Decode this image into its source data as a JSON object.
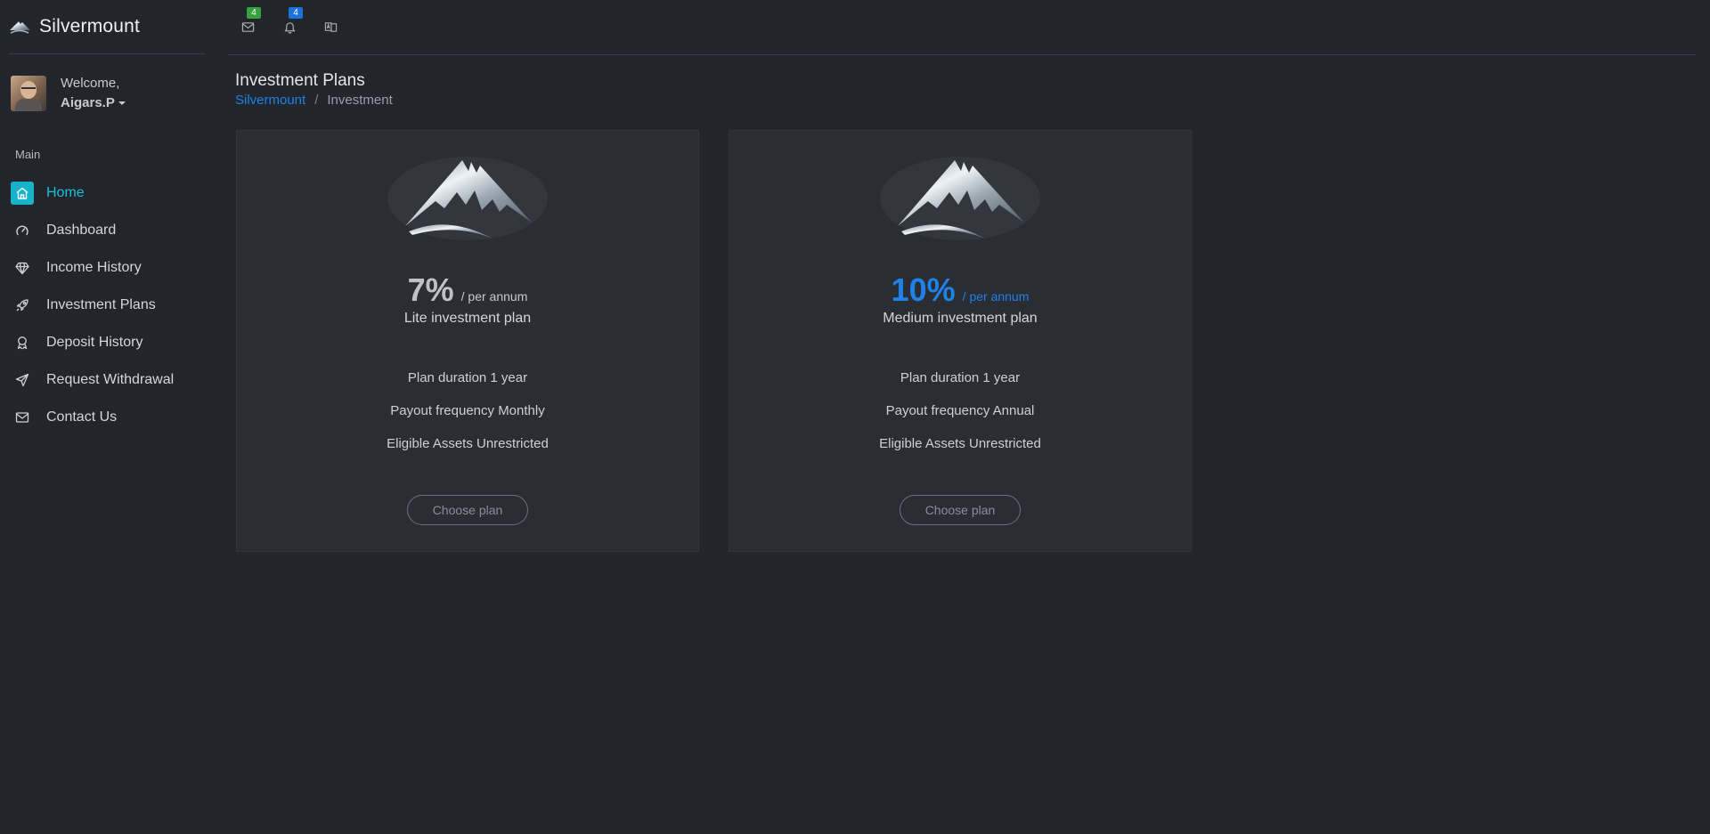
{
  "brand": {
    "name": "Silvermount",
    "logo_icon": "mountain-logo-icon"
  },
  "user": {
    "welcome": "Welcome,",
    "name": "Aigars.P"
  },
  "sidebar": {
    "section_label": "Main",
    "items": [
      {
        "label": "Home",
        "icon": "home-icon",
        "active": true
      },
      {
        "label": "Dashboard",
        "icon": "gauge-icon"
      },
      {
        "label": "Income History",
        "icon": "diamond-icon"
      },
      {
        "label": "Investment Plans",
        "icon": "rocket-icon"
      },
      {
        "label": "Deposit History",
        "icon": "award-icon"
      },
      {
        "label": "Request Withdrawal",
        "icon": "send-icon"
      },
      {
        "label": "Contact Us",
        "icon": "mail-icon"
      }
    ]
  },
  "topbar": {
    "messages_badge": "4",
    "notifications_badge": "4",
    "icons": [
      "mail-icon",
      "bell-icon",
      "language-icon"
    ]
  },
  "page": {
    "title": "Investment Plans",
    "breadcrumb": {
      "root": "Silvermount",
      "separator": "/",
      "current": "Investment"
    }
  },
  "plans": [
    {
      "rate": "7%",
      "unit": "/ per annum",
      "name": "Lite investment plan",
      "features": [
        "Plan duration 1 year",
        "Payout frequency Monthly",
        "Eligible Assets Unrestricted"
      ],
      "button": "Choose plan"
    },
    {
      "rate": "10%",
      "unit": "/ per annum",
      "name": "Medium investment plan",
      "features": [
        "Plan duration 1 year",
        "Payout frequency Annual",
        "Eligible Assets Unrestricted"
      ],
      "button": "Choose plan"
    }
  ],
  "colors": {
    "background": "#22252b",
    "card": "#2a2d33",
    "accent_cyan": "#17b3c9",
    "accent_blue": "#1e82e8",
    "badge_green": "#37a13f",
    "badge_blue": "#1d72d9"
  }
}
